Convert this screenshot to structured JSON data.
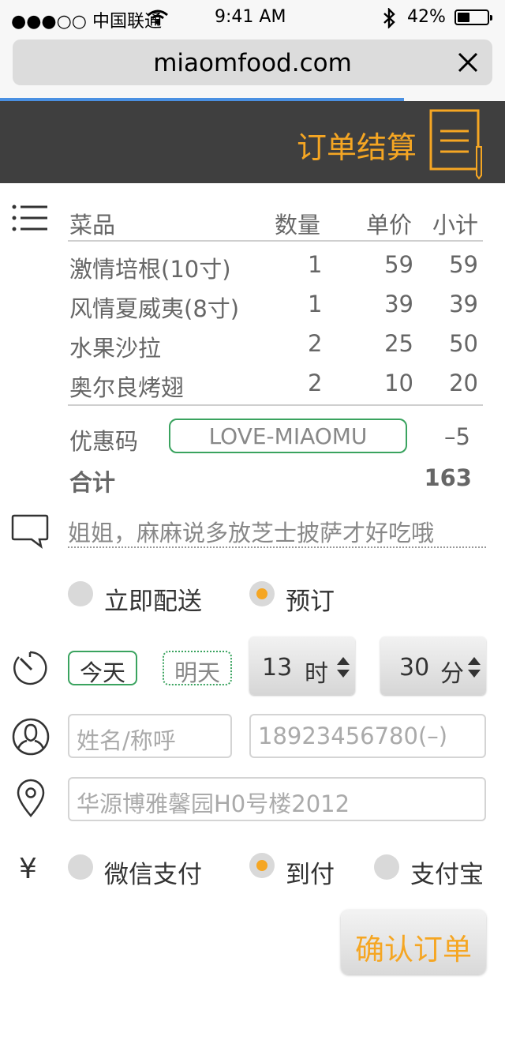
{
  "status_bar": {
    "carrier": "●●●○○ 中国联通",
    "time": "9:41 AM",
    "battery": "42%",
    "battery_level": 0.42
  },
  "browser": {
    "url": "miaomfood.com",
    "load_progress": 0.8
  },
  "header": {
    "title": "订单结算"
  },
  "order": {
    "columns": {
      "name": "菜品",
      "qty": "数量",
      "price": "单价",
      "subtotal": "小计"
    },
    "items": [
      {
        "name": "激情培根(10寸)",
        "qty": "1",
        "price": "59",
        "subtotal": "59"
      },
      {
        "name": "风情夏威夷(8寸)",
        "qty": "1",
        "price": "39",
        "subtotal": "39"
      },
      {
        "name": "水果沙拉",
        "qty": "2",
        "price": "25",
        "subtotal": "50"
      },
      {
        "name": "奥尔良烤翅",
        "qty": "2",
        "price": "10",
        "subtotal": "20"
      }
    ],
    "coupon_label": "优惠码",
    "coupon_code": "LOVE-MIAOMU",
    "discount": "–5",
    "total_label": "合计",
    "total": "163"
  },
  "remark": {
    "text": "姐姐，麻麻说多放芝士披萨才好吃哦"
  },
  "delivery": {
    "options": [
      {
        "label": "立即配送",
        "selected": false
      },
      {
        "label": "预订",
        "selected": true
      }
    ]
  },
  "schedule": {
    "today": "今天",
    "tomorrow": "明天",
    "hour": "13",
    "hour_unit": "时",
    "minute": "30",
    "minute_unit": "分"
  },
  "contact": {
    "name_placeholder": "姓名/称呼",
    "phone_placeholder": "18923456780(–)",
    "address_placeholder": "华源博雅馨园H0号楼2012"
  },
  "payment": {
    "currency_symbol": "¥",
    "options": [
      {
        "label": "微信支付",
        "selected": false
      },
      {
        "label": "到付",
        "selected": true
      },
      {
        "label": "支付宝",
        "selected": false
      }
    ]
  },
  "confirm_label": "确认订单",
  "colors": {
    "accent": "#f5a623",
    "green": "#3aa35f",
    "header_bg": "#3f3f3f",
    "progress": "#4a90e2"
  }
}
